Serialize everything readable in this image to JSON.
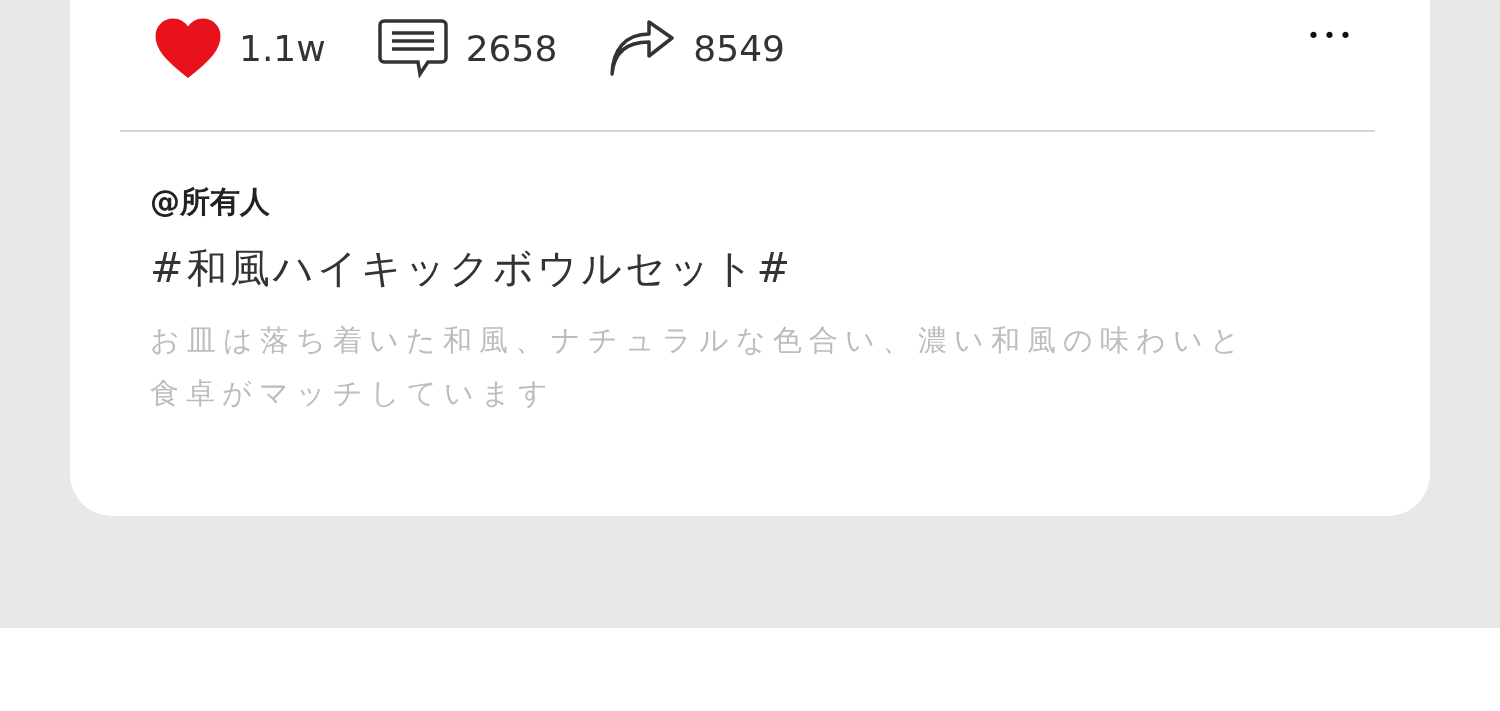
{
  "actions": [
    {
      "kind": "like",
      "count": "1.1w",
      "liked": true
    },
    {
      "kind": "comment",
      "count": "2658"
    },
    {
      "kind": "share",
      "count": "8549"
    }
  ],
  "more": "•••",
  "post": {
    "mention": "@所有人",
    "title": "#和風ハイキックボウルセット#",
    "description": "お皿は落ち着いた和風、ナチュラルな色合い、濃い和風の味わいと食卓がマッチしています"
  }
}
